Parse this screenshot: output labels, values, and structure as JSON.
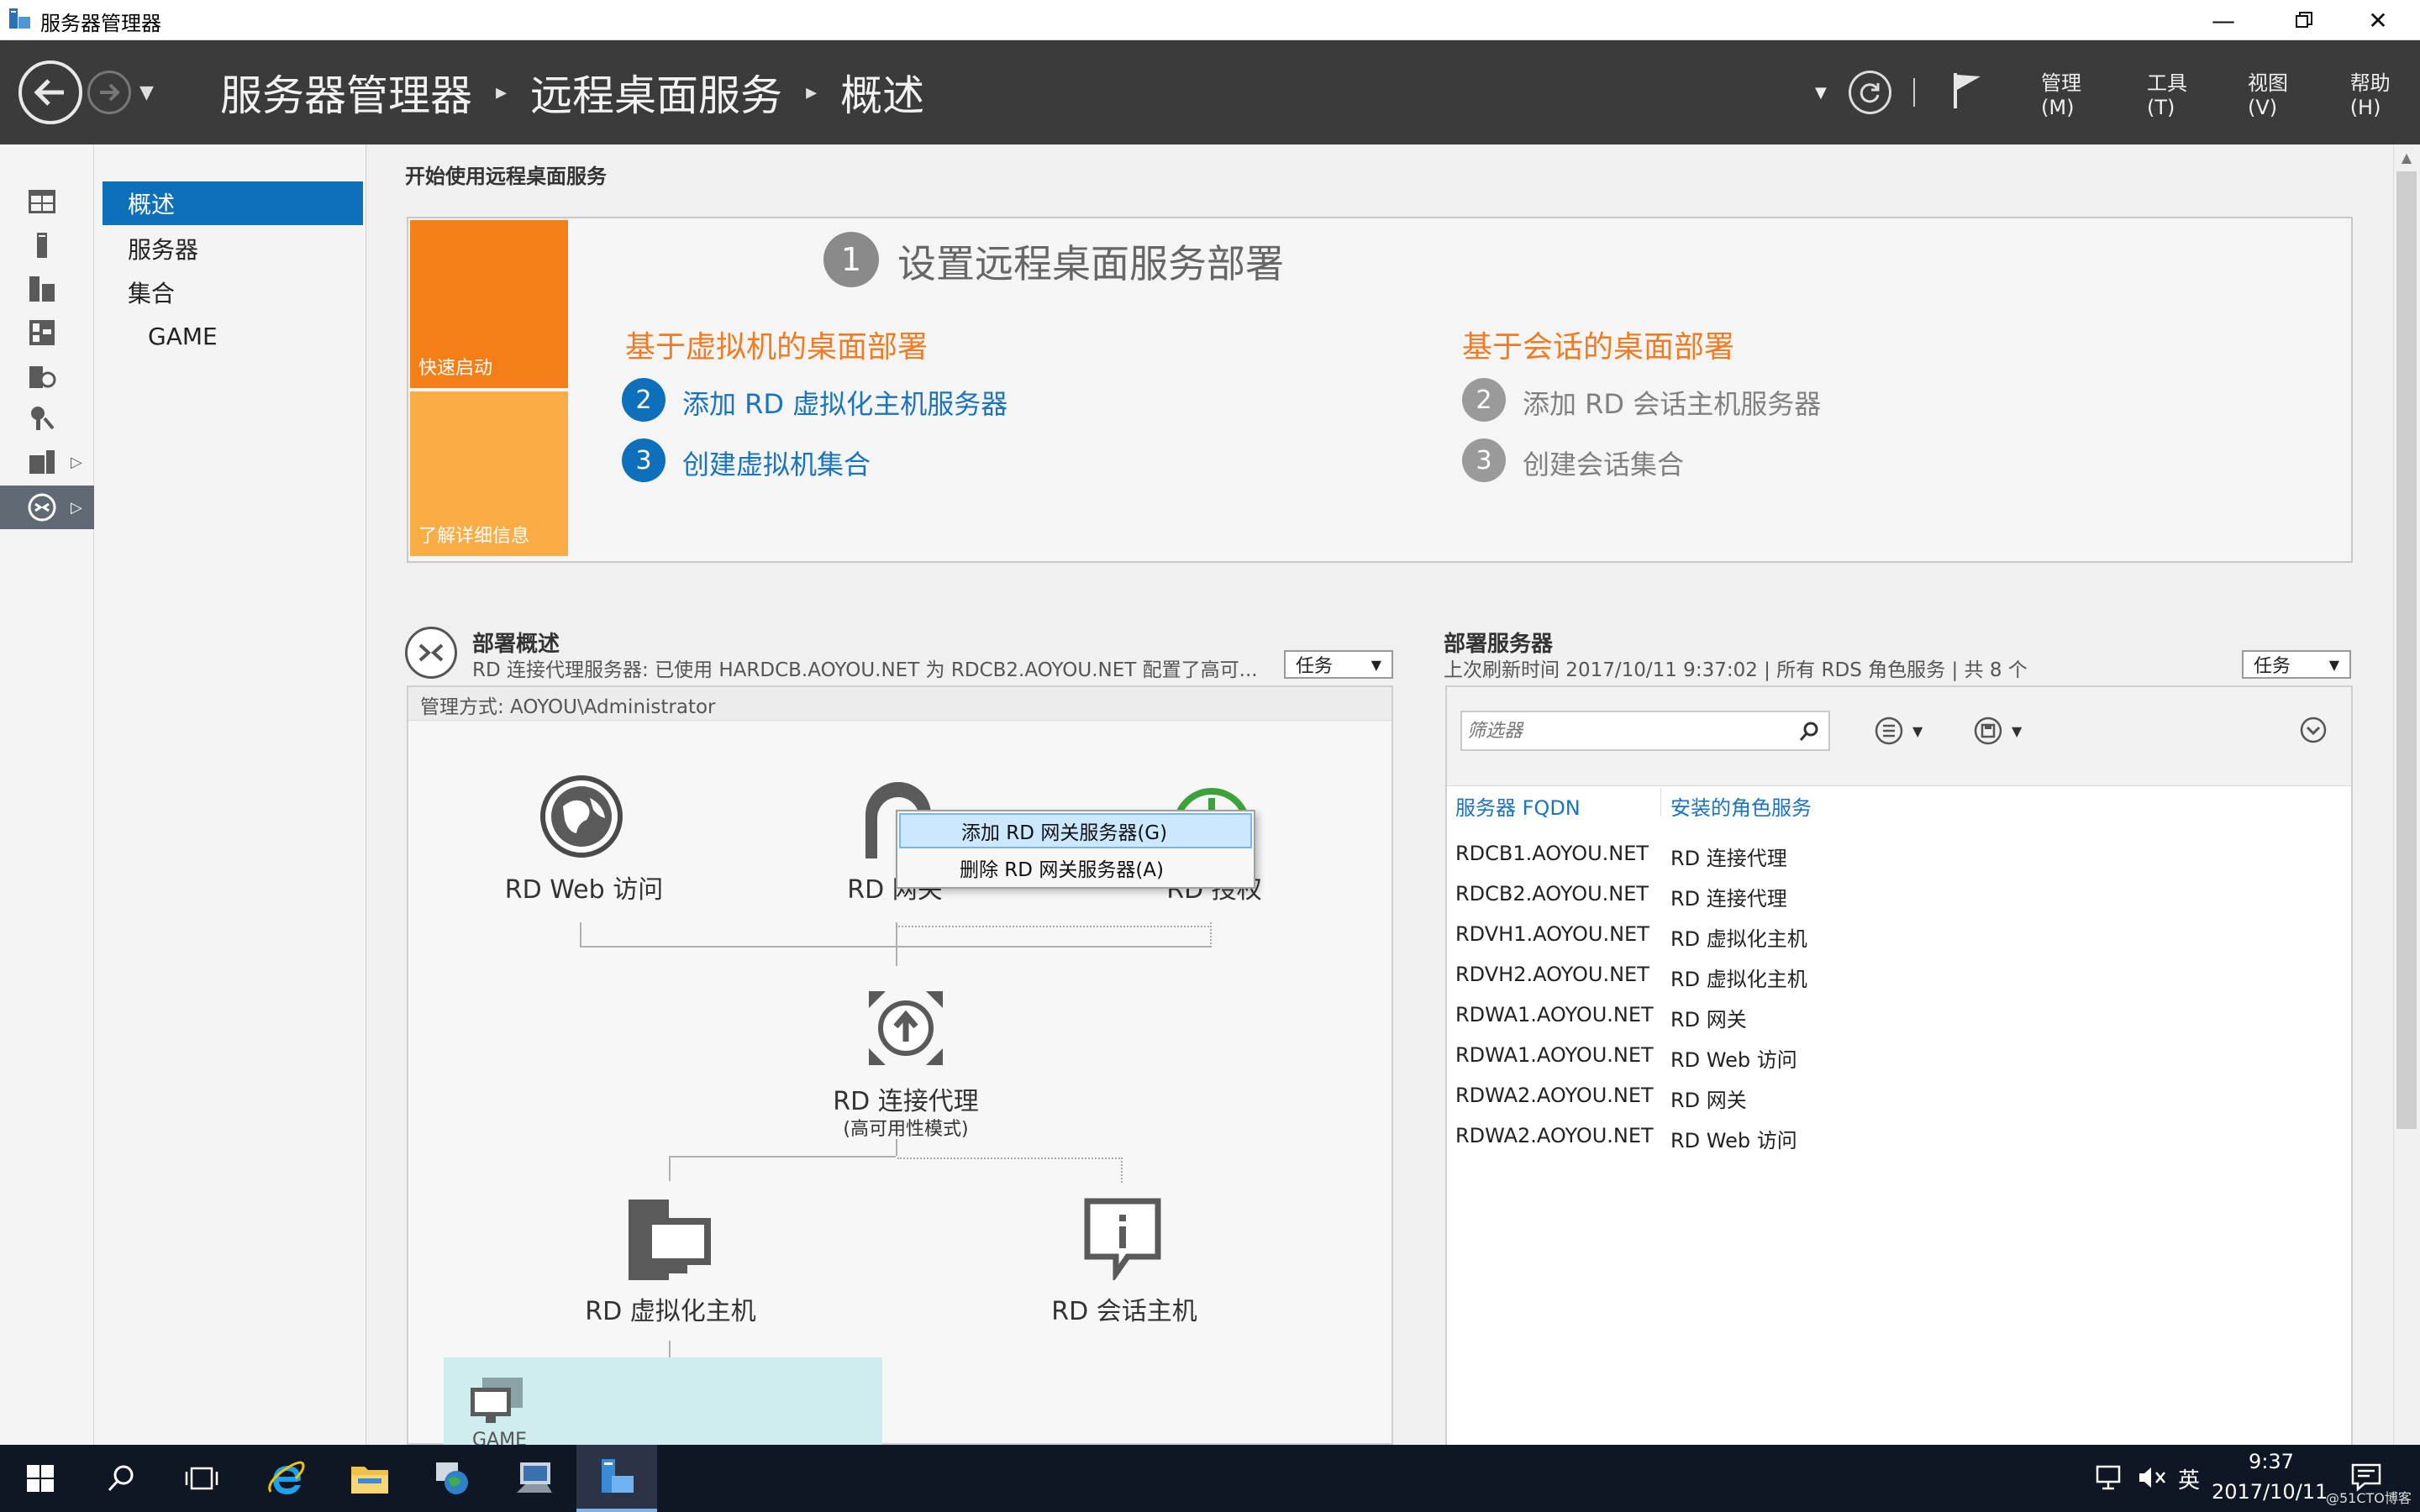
{
  "window": {
    "title": "服务器管理器"
  },
  "header": {
    "breadcrumb": [
      "服务器管理器",
      "远程桌面服务",
      "概述"
    ],
    "menus": [
      "管理(M)",
      "工具(T)",
      "视图(V)",
      "帮助(H)"
    ]
  },
  "subnav": {
    "items": [
      "概述",
      "服务器",
      "集合",
      "GAME"
    ]
  },
  "quickstart": {
    "section_title": "开始使用远程桌面服务",
    "tile_quick": "快速启动",
    "tile_learn": "了解详细信息",
    "step1_number": "1",
    "step1_title": "设置远程桌面服务部署",
    "vm_heading": "基于虚拟机的桌面部署",
    "session_heading": "基于会话的桌面部署",
    "vm_steps": [
      {
        "num": "2",
        "label": "添加 RD 虚拟化主机服务器"
      },
      {
        "num": "3",
        "label": "创建虚拟机集合"
      }
    ],
    "session_steps": [
      {
        "num": "2",
        "label": "添加 RD 会话主机服务器"
      },
      {
        "num": "3",
        "label": "创建会话集合"
      }
    ]
  },
  "overview": {
    "title": "部署概述",
    "subtitle": "RD 连接代理服务器: 已使用 HARDCB.AOYOU.NET 为 RDCB2.AOYOU.NET 配置了高可...",
    "tasks_label": "任务",
    "manage_by": "管理方式: AOYOU\\Administrator",
    "roles": {
      "web": "RD Web 访问",
      "gateway": "RD 网关",
      "licensing": "RD 授权",
      "broker": "RD 连接代理",
      "broker_mode": "(高可用性模式)",
      "virt_host": "RD 虚拟化主机",
      "session_host": "RD 会话主机",
      "collection": "GAME"
    }
  },
  "context_menu": {
    "items": [
      "添加 RD 网关服务器(G)",
      "删除 RD 网关服务器(A)"
    ]
  },
  "servers": {
    "title": "部署服务器",
    "subtitle": "上次刷新时间 2017/10/11 9:37:02 | 所有 RDS 角色服务 | 共 8 个",
    "tasks_label": "任务",
    "filter_placeholder": "筛选器",
    "columns": [
      "服务器 FQDN",
      "安装的角色服务"
    ],
    "rows": [
      [
        "RDCB1.AOYOU.NET",
        "RD 连接代理"
      ],
      [
        "RDCB2.AOYOU.NET",
        "RD 连接代理"
      ],
      [
        "RDVH1.AOYOU.NET",
        "RD 虚拟化主机"
      ],
      [
        "RDVH2.AOYOU.NET",
        "RD 虚拟化主机"
      ],
      [
        "RDWA1.AOYOU.NET",
        "RD 网关"
      ],
      [
        "RDWA1.AOYOU.NET",
        "RD Web 访问"
      ],
      [
        "RDWA2.AOYOU.NET",
        "RD 网关"
      ],
      [
        "RDWA2.AOYOU.NET",
        "RD Web 访问"
      ]
    ]
  },
  "taskbar": {
    "ime": "英",
    "time": "9:37",
    "date": "2017/10/11",
    "watermark": "@51CTO博客"
  },
  "colors": {
    "accent": "#0e6fba",
    "header_bg": "#3b3b3b",
    "orange": "#f57f17",
    "light_orange": "#fbac44",
    "link_blue": "#1a73c0"
  }
}
